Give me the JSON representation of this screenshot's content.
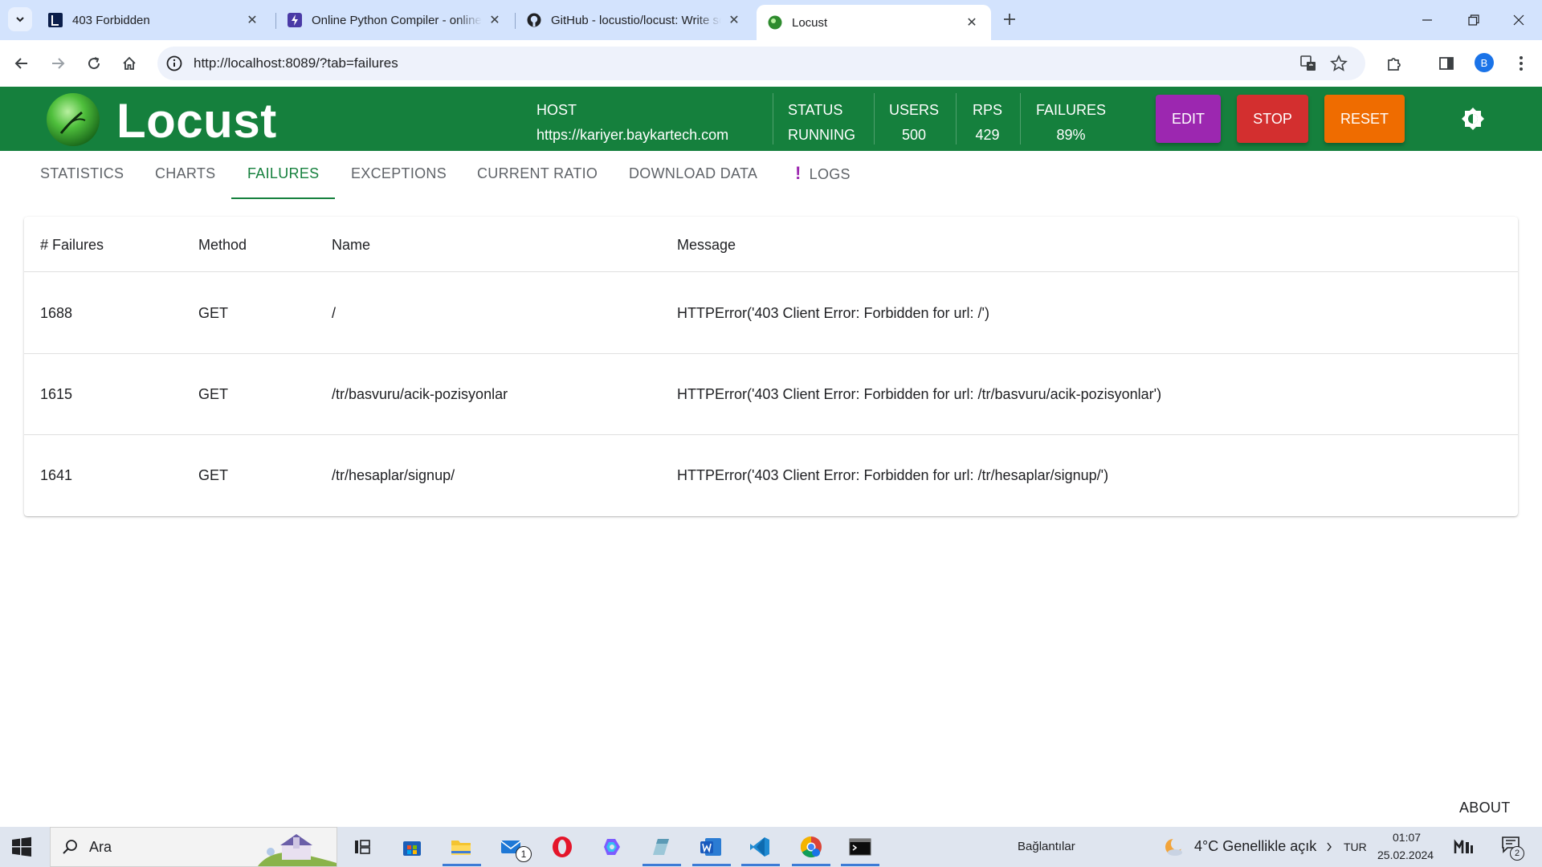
{
  "browser": {
    "tabs": [
      {
        "title": "403 Forbidden",
        "close": "✕"
      },
      {
        "title": "Online Python Compiler - online editor",
        "close": "✕"
      },
      {
        "title": "GitHub - locustio/locust: Write scalable load tests",
        "close": "✕"
      },
      {
        "title": "Locust",
        "close": "✕"
      }
    ],
    "url": "http://localhost:8089/?tab=failures",
    "profile_initial": "B"
  },
  "app": {
    "brand": "Locust",
    "host_label": "HOST",
    "host_value": "https://kariyer.baykartech.com",
    "status_label": "STATUS",
    "status_value": "RUNNING",
    "users_label": "USERS",
    "users_value": "500",
    "rps_label": "RPS",
    "rps_value": "429",
    "failures_label": "FAILURES",
    "failures_value": "89%",
    "buttons": {
      "edit": "EDIT",
      "stop": "STOP",
      "reset": "RESET"
    },
    "colors": {
      "header": "#15803d",
      "edit": "#9c27b0",
      "stop": "#d32f2f",
      "reset": "#ef6c00"
    }
  },
  "tabs": {
    "statistics": "STATISTICS",
    "charts": "CHARTS",
    "failures": "FAILURES",
    "exceptions": "EXCEPTIONS",
    "current_ratio": "CURRENT RATIO",
    "download_data": "DOWNLOAD DATA",
    "logs_flag": "!",
    "logs": "LOGS",
    "active": "FAILURES"
  },
  "failures_table": {
    "headers": [
      "# Failures",
      "Method",
      "Name",
      "Message"
    ],
    "rows": [
      [
        "1688",
        "GET",
        "/",
        "HTTPError('403 Client Error: Forbidden for url: /')"
      ],
      [
        "1615",
        "GET",
        "/tr/basvuru/acik-pozisyonlar",
        "HTTPError('403 Client Error: Forbidden for url: /tr/basvuru/acik-pozisyonlar')"
      ],
      [
        "1641",
        "GET",
        "/tr/hesaplar/signup/",
        "HTTPError('403 Client Error: Forbidden for url: /tr/hesaplar/signup/')"
      ]
    ]
  },
  "footer": {
    "about": "ABOUT"
  },
  "taskbar": {
    "search_placeholder": "Ara",
    "mail_badge": "1",
    "links_label": "Bağlantılar",
    "weather": "4°C  Genellikle açık",
    "language": "TUR",
    "time": "01:07",
    "date": "25.02.2024",
    "notification_badge": "2"
  }
}
